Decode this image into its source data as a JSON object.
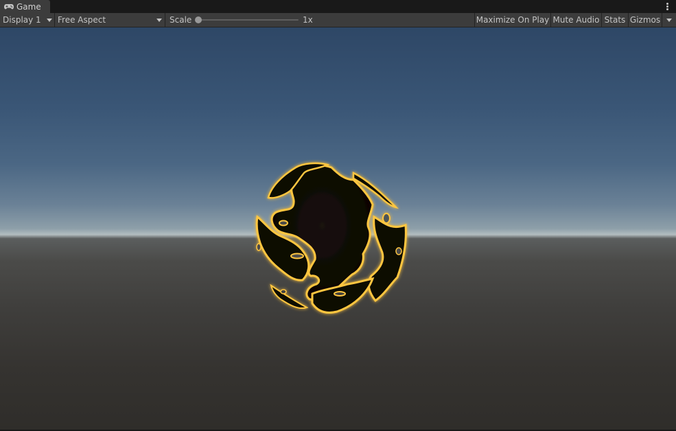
{
  "tab": {
    "label": "Game",
    "icon": "gamepad-icon"
  },
  "toolbar": {
    "display": "Display 1",
    "aspect": "Free Aspect",
    "scale_label": "Scale",
    "scale_value": "1x",
    "scale_level": 0,
    "maximize_on_play": "Maximize On Play",
    "mute_audio": "Mute Audio",
    "stats": "Stats",
    "gizmos": "Gizmos"
  },
  "colors": {
    "panel": "#3c3c3c",
    "tab_strip": "#191919",
    "text": "#c4c4c4",
    "sky_top": "#2e4766",
    "horizon": "#b2bdc0",
    "ground": "#2f2d2a",
    "lava_glow": "#ffc640",
    "sphere_dark": "#0c0805"
  }
}
